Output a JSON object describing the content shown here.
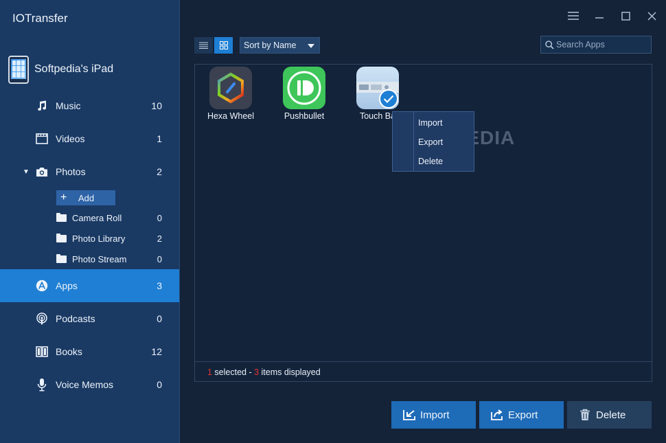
{
  "app": {
    "title": "IOTransfer"
  },
  "device": {
    "name": "Softpedia's iPad"
  },
  "nav": {
    "music": {
      "label": "Music",
      "count": "10"
    },
    "videos": {
      "label": "Videos",
      "count": "1"
    },
    "photos": {
      "label": "Photos",
      "count": "2"
    },
    "apps": {
      "label": "Apps",
      "count": "3"
    },
    "podcasts": {
      "label": "Podcasts",
      "count": "0"
    },
    "books": {
      "label": "Books",
      "count": "12"
    },
    "voice_memos": {
      "label": "Voice Memos",
      "count": "0"
    }
  },
  "photos_sub": {
    "add_label": "Add",
    "camera_roll": {
      "label": "Camera Roll",
      "count": "0"
    },
    "photo_library": {
      "label": "Photo Library",
      "count": "2"
    },
    "photo_stream": {
      "label": "Photo Stream",
      "count": "0"
    }
  },
  "toolbar": {
    "sort_label": "Sort by Name",
    "search_placeholder": "Search Apps"
  },
  "apps": [
    {
      "name": "Hexa Wheel",
      "icon": "hexa-wheel-icon",
      "selected": false
    },
    {
      "name": "Pushbullet",
      "icon": "pushbullet-icon",
      "selected": false
    },
    {
      "name": "Touch Bar",
      "display_name": "Touch Ba",
      "icon": "touch-bar-icon",
      "selected": true
    }
  ],
  "context_menu": {
    "import": "Import",
    "export": "Export",
    "delete": "Delete"
  },
  "status": {
    "selected": "1",
    "selected_text": " selected - ",
    "displayed": "3",
    "displayed_text": " items displayed"
  },
  "buttons": {
    "import": "Import",
    "export": "Export",
    "delete": "Delete"
  },
  "watermark": "SOFTPEDIA",
  "colors": {
    "accent": "#1e7fd4",
    "sidebar": "#1a3a64",
    "background": "#142338",
    "status_red": "#e8342f"
  }
}
